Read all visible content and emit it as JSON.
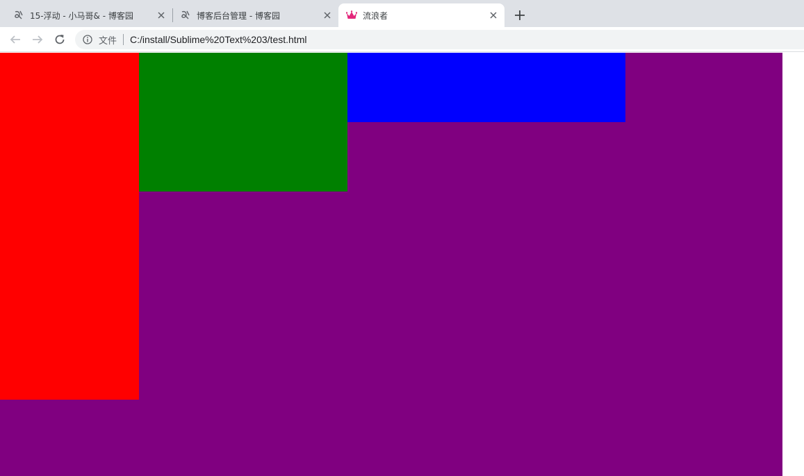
{
  "tabs": [
    {
      "title": "15-浮动 - 小马哥& - 博客园",
      "icon": "cnblogs-icon",
      "active": false
    },
    {
      "title": "博客后台管理 - 博客园",
      "icon": "cnblogs-icon",
      "active": false
    },
    {
      "title": "流浪者",
      "icon": "crown-icon",
      "active": true
    }
  ],
  "toolbar": {
    "scheme_label": "文件",
    "url": "C:/install/Sublime%20Text%203/test.html"
  },
  "colors": {
    "purple": "#800080",
    "red": "#ff0000",
    "green": "#008000",
    "blue": "#0000ff",
    "crown": "#e3277b"
  }
}
